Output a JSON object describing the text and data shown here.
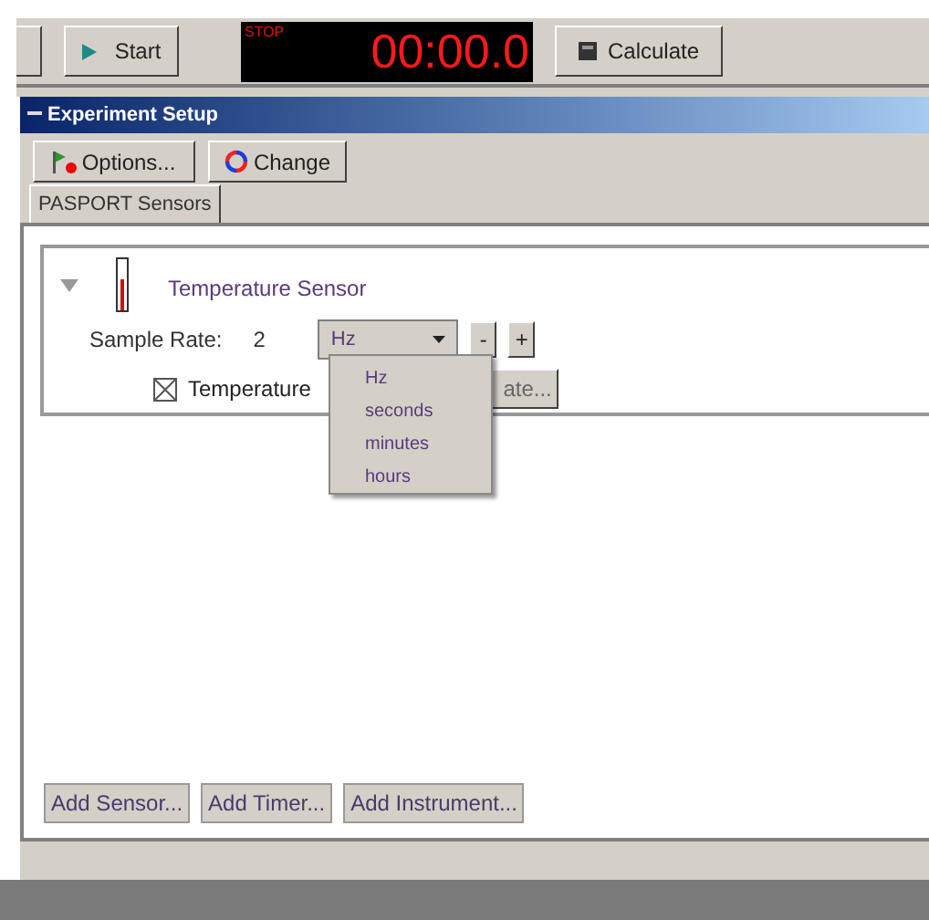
{
  "toolbar": {
    "start_button": "Start",
    "timer": {
      "state": "STOP",
      "time": "00:00.0"
    },
    "calculate_button": "Calculate"
  },
  "panel": {
    "title": "Experiment Setup",
    "expanded": true
  },
  "panel_buttons": [
    "Options...",
    "Change"
  ],
  "tabs": [
    {
      "label": "PASPORT Sensors",
      "selected": true
    }
  ],
  "sensor": {
    "name": "Temperature Sensor",
    "expanded": true,
    "sample_rate_label": "Sample Rate:",
    "sample_rate_value": "2",
    "unit": "Hz",
    "minus": "-",
    "plus": "+",
    "measurement": {
      "label": "Temperature",
      "checked": true
    },
    "update_button": "ate...",
    "unit_menu": {
      "open": true,
      "items": [
        "Hz",
        "seconds",
        "minutes",
        "hours"
      ]
    }
  },
  "bottom_buttons": [
    "Add Sensor...",
    "Add Timer...",
    "Add Instrument..."
  ]
}
